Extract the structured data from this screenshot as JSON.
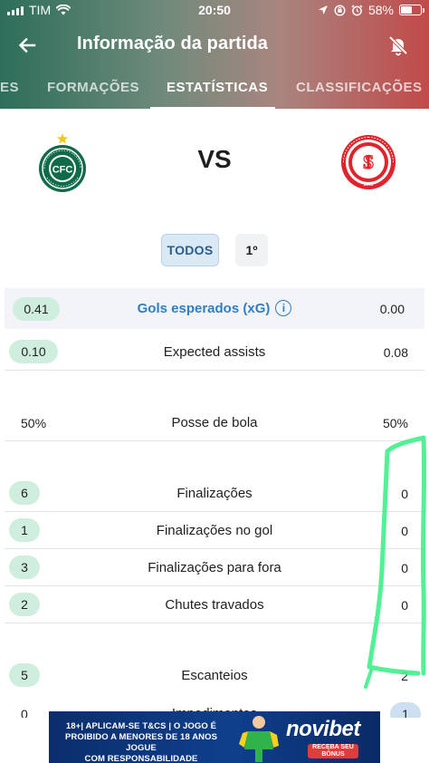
{
  "status_bar": {
    "carrier": "TIM",
    "time": "20:50",
    "battery": "58%"
  },
  "app_bar": {
    "title": "Informação da partida"
  },
  "tabs": [
    {
      "label": "ES",
      "active": false
    },
    {
      "label": "FORMAÇÕES",
      "active": false
    },
    {
      "label": "ESTATÍSTICAS",
      "active": true
    },
    {
      "label": "CLASSIFICAÇÕES",
      "active": false
    }
  ],
  "match": {
    "vs_label": "VS",
    "home_crest_text": "CFC",
    "home_crest_ring_text": "CORITIBA FOOT BALL CLUB · PARANÁ",
    "away_crest_ring_text": "SPORT CLUB INTERNACIONAL · 1909"
  },
  "periods": {
    "all": "TODOS",
    "first": "1º"
  },
  "stats": [
    {
      "label": "Gols esperados (xG)",
      "home": "0.41",
      "away": "0.00"
    },
    {
      "label": "Expected assists",
      "home": "0.10",
      "away": "0.08"
    },
    {
      "label": "Posse de bola",
      "home": "50%",
      "away": "50%"
    },
    {
      "label": "Finalizações",
      "home": "6",
      "away": "0"
    },
    {
      "label": "Finalizações no gol",
      "home": "1",
      "away": "0"
    },
    {
      "label": "Finalizações para fora",
      "home": "3",
      "away": "0"
    },
    {
      "label": "Chutes travados",
      "home": "2",
      "away": "0"
    },
    {
      "label": "Escanteios",
      "home": "5",
      "away": "2"
    },
    {
      "label": "Impedimentos",
      "home": "0",
      "away": "1"
    }
  ],
  "ad": {
    "line1": "18+| APLICAM-SE T&CS | O JOGO É",
    "line2": "PROIBIDO A MENORES DE 18 ANOS JOGUE",
    "line3": "COM RESPONSABILIDADE",
    "brand": "novibet",
    "cta": "RECEBA SEU BÔNUS"
  },
  "colors": {
    "home_green": "#0f6b4a",
    "away_red": "#e0242d",
    "pill_green": "#cfeedd",
    "xg_blue": "#2f7fc1",
    "annotation_green": "#3ef08a"
  },
  "icons": {
    "back": "arrow-left-icon",
    "mute": "bell-off-icon",
    "info": "info-icon"
  }
}
